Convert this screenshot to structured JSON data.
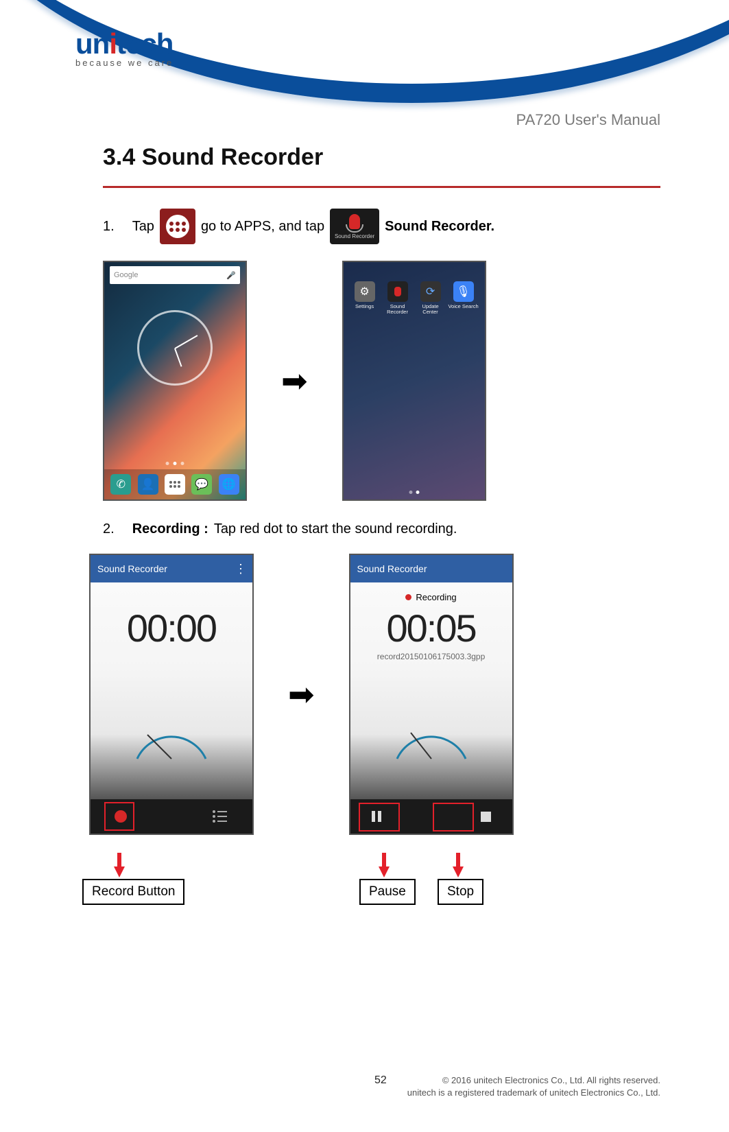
{
  "logo": {
    "brand_pre": "un",
    "brand_dot": "i",
    "brand_post": "tech",
    "tagline": "because we care"
  },
  "doc_title": "PA720 User's Manual",
  "section_heading": "3.4 Sound Recorder",
  "step1": {
    "num": "1.",
    "text_a": "Tap",
    "text_b": "go to APPS, and tap",
    "text_c": "Sound Recorder."
  },
  "inline_icons": {
    "recorder_label": "Sound Recorder"
  },
  "home_screen": {
    "search_placeholder": "Google"
  },
  "drawer_apps": [
    {
      "name": "Settings"
    },
    {
      "name": "Sound Recorder"
    },
    {
      "name": "Update Center"
    },
    {
      "name": "Voice Search"
    }
  ],
  "step2": {
    "num": "2.",
    "bold": "Recording :",
    "rest": " Tap red dot to start the sound recording."
  },
  "recorder_idle": {
    "header": "Sound Recorder",
    "timer": "00:00"
  },
  "recorder_active": {
    "header": "Sound Recorder",
    "status": "Recording",
    "timer": "00:05",
    "filename": "record20150106175003.3gpp"
  },
  "callouts": {
    "record": "Record Button",
    "pause": "Pause",
    "stop": "Stop"
  },
  "footer": {
    "page": "52",
    "copyright_line1": "© 2016 unitech Electronics Co., Ltd. All rights reserved.",
    "copyright_line2": "unitech is a registered trademark of unitech Electronics Co., Ltd."
  }
}
